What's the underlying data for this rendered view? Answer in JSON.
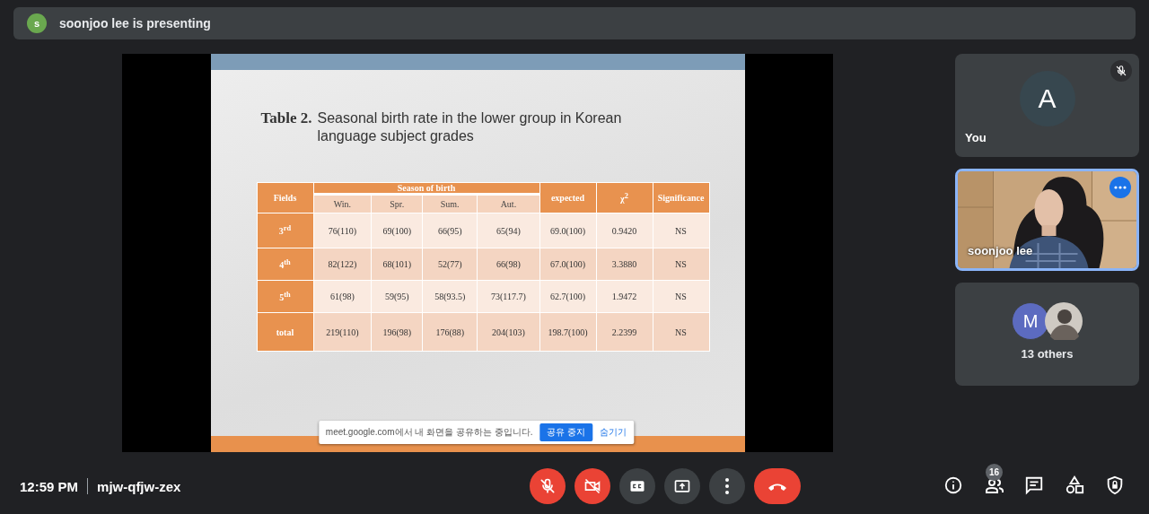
{
  "presenting_banner": {
    "avatar_letter": "s",
    "text": "soonjoo lee is presenting"
  },
  "slide": {
    "title_label": "Table 2.",
    "title": "Seasonal birth rate in the lower group in Korean language subject grades",
    "table": {
      "fields_header": "Fields",
      "group_header": "Season of birth",
      "subcolumns": [
        "Win.",
        "Spr.",
        "Sum.",
        "Aut."
      ],
      "trailing_headers": [
        "expected",
        "χ$^{2}$",
        "Significance"
      ],
      "rows": [
        {
          "field": "3$^{rd}$",
          "cells": [
            "76(110)",
            "69(100)",
            "66(95)",
            "65(94)",
            "69.0(100)",
            "0.9420",
            "NS"
          ]
        },
        {
          "field": "4$^{th}$",
          "cells": [
            "82(122)",
            "68(101)",
            "52(77)",
            "66(98)",
            "67.0(100)",
            "3.3880",
            "NS"
          ]
        },
        {
          "field": "5$^{th}$",
          "cells": [
            "61(98)",
            "59(95)",
            "58(93.5)",
            "73(117.7)",
            "62.7(100)",
            "1.9472",
            "NS"
          ]
        },
        {
          "field": "total",
          "cells": [
            "219(110)",
            "196(98)",
            "176(88)",
            "204(103)",
            "198.7(100)",
            "2.2399",
            "NS"
          ]
        }
      ]
    }
  },
  "share_notice": {
    "text": "meet.google.com에서 내 화면을 공유하는 중입니다.",
    "stop_button": "공유 중지",
    "hide_button": "숨기기"
  },
  "participants": [
    {
      "kind": "avatar",
      "letter": "A",
      "name": "You",
      "muted": true
    },
    {
      "kind": "video",
      "name": "soonjoo lee",
      "muted": false
    },
    {
      "kind": "group",
      "letter": "M",
      "label": "13 others"
    }
  ],
  "meeting": {
    "time": "12:59 PM",
    "code": "mjw-qfjw-zex"
  },
  "controls": [
    {
      "kind": "mic",
      "on": false
    },
    {
      "kind": "camera",
      "on": false
    },
    {
      "kind": "captions",
      "on": false
    },
    {
      "kind": "present"
    },
    {
      "kind": "more"
    },
    {
      "kind": "leave"
    }
  ],
  "side_controls": [
    {
      "kind": "info"
    },
    {
      "kind": "people",
      "badge": "16"
    },
    {
      "kind": "chat"
    },
    {
      "kind": "activities"
    },
    {
      "kind": "host"
    }
  ]
}
